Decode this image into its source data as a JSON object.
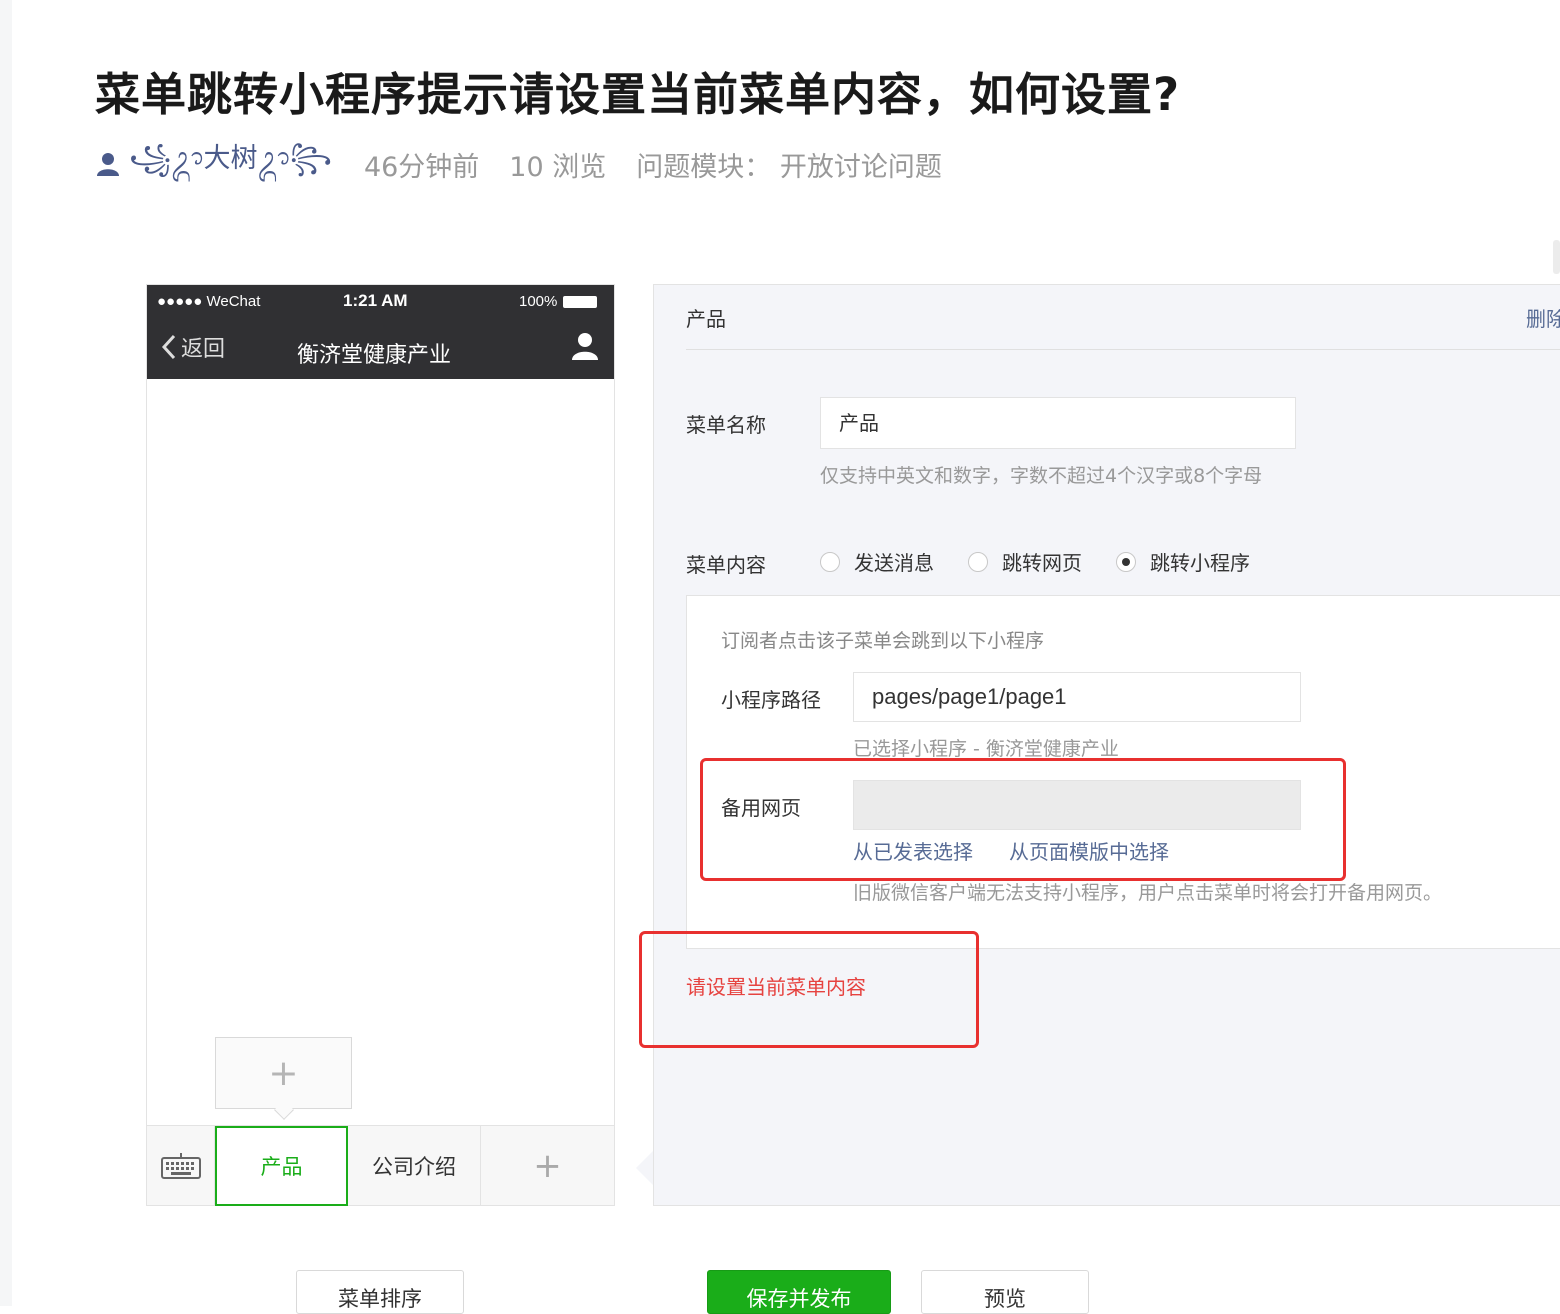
{
  "post": {
    "title": "菜单跳转小程序提示请设置当前菜单内容，如何设置?",
    "author": "꧁ᬊ大树ᬊ꧂",
    "time": "46分钟前",
    "views": "10 浏览",
    "module": "问题模块：  开放讨论问题"
  },
  "phone": {
    "carrier": "●●●●● WeChat",
    "time": "1:21 AM",
    "battery": "100%",
    "back_label": "返回",
    "title": "衡济堂健康产业",
    "submenu_add": "+",
    "tabs": [
      "产品",
      "公司介绍",
      "+"
    ]
  },
  "editor": {
    "header": "产品",
    "delete_label": "删除",
    "menu_name_label": "菜单名称",
    "menu_name_value": "产品",
    "menu_name_hint": "仅支持中英文和数字，字数不超过4个汉字或8个字母",
    "content_label": "菜单内容",
    "options": [
      {
        "label": "发送消息",
        "selected": false
      },
      {
        "label": "跳转网页",
        "selected": false
      },
      {
        "label": "跳转小程序",
        "selected": true
      }
    ],
    "mini_intro": "订阅者点击该子菜单会跳到以下小程序",
    "path_label": "小程序路径",
    "path_value": "pages/page1/page1",
    "selected_program": "已选择小程序 - 衡济堂健康产业",
    "backup_label": "备用网页",
    "backup_value": "",
    "link_published": "从已发表选择",
    "link_template": "从页面模版中选择",
    "backup_hint": "旧版微信客户端无法支持小程序，用户点击菜单时将会打开备用网页。",
    "error": "请设置当前菜单内容"
  },
  "buttons": {
    "sort": "菜单排序",
    "save": "保存并发布",
    "preview": "预览"
  },
  "colors": {
    "accent_green": "#1aad19",
    "link_blue": "#576b95",
    "error_red": "#e64340",
    "highlight_red": "#e8302f"
  }
}
